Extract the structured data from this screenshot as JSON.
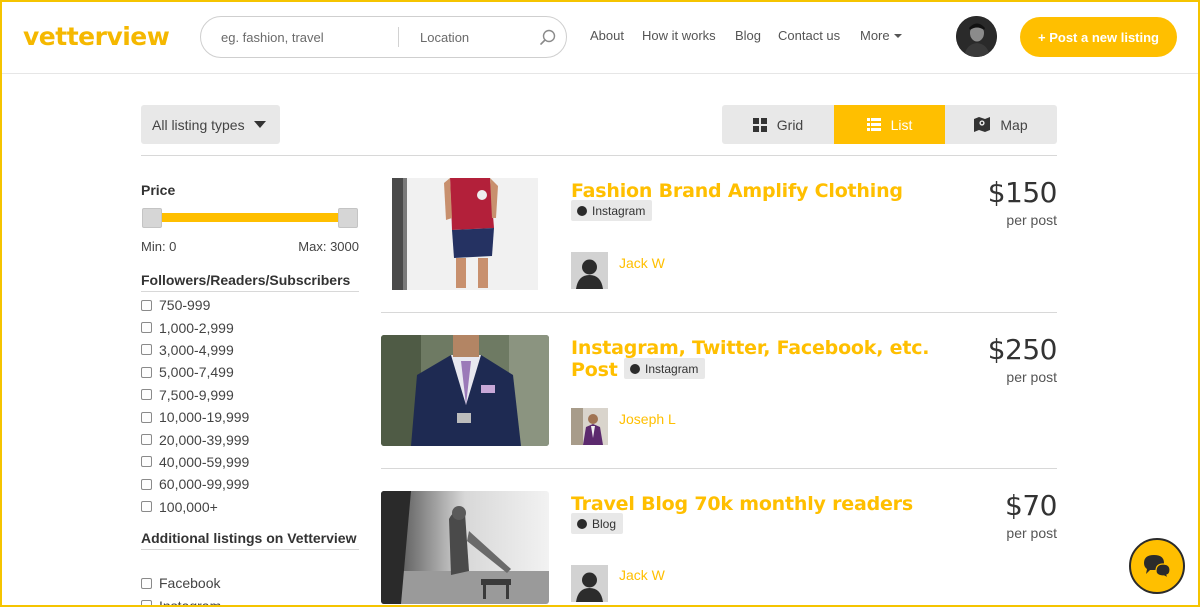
{
  "header": {
    "logo": "vetterview",
    "search_placeholder": "eg. fashion, travel",
    "location_placeholder": "Location",
    "nav": {
      "about": "About",
      "how_it_works": "How it works",
      "blog": "Blog",
      "contact": "Contact us",
      "more": "More"
    },
    "post_button": "+ Post a new listing"
  },
  "toolbar": {
    "listing_types": "All listing types",
    "views": {
      "grid": "Grid",
      "list": "List",
      "map": "Map",
      "active": "List"
    }
  },
  "sidebar": {
    "price": {
      "heading": "Price",
      "min_label": "Min: 0",
      "max_label": "Max: 3000"
    },
    "followers": {
      "heading": "Followers/Readers/Subscribers",
      "options": [
        "750-999",
        "1,000-2,999",
        "3,000-4,999",
        "5,000-7,499",
        "7,500-9,999",
        "10,000-19,999",
        "20,000-39,999",
        "40,000-59,999",
        "60,000-99,999",
        "100,000+"
      ]
    },
    "additional": {
      "heading": "Additional listings on Vetterview",
      "options": [
        "Facebook",
        "Instagram"
      ]
    }
  },
  "listings": [
    {
      "title": "Fashion Brand Amplify Clothing",
      "tag": "Instagram",
      "author": "Jack W",
      "price": "$150",
      "unit": "per post"
    },
    {
      "title_line1": "Instagram, Twitter, Facebook, etc.",
      "title_line2": "Post",
      "tag": "Instagram",
      "author": "Joseph L",
      "price": "$250",
      "unit": "per post"
    },
    {
      "title": "Travel Blog 70k monthly readers",
      "tag": "Blog",
      "author": "Jack W",
      "price": "$70",
      "unit": "per post"
    }
  ],
  "colors": {
    "accent": "#ffbf00",
    "logo": "#f5b800",
    "frame": "#f5c400"
  }
}
